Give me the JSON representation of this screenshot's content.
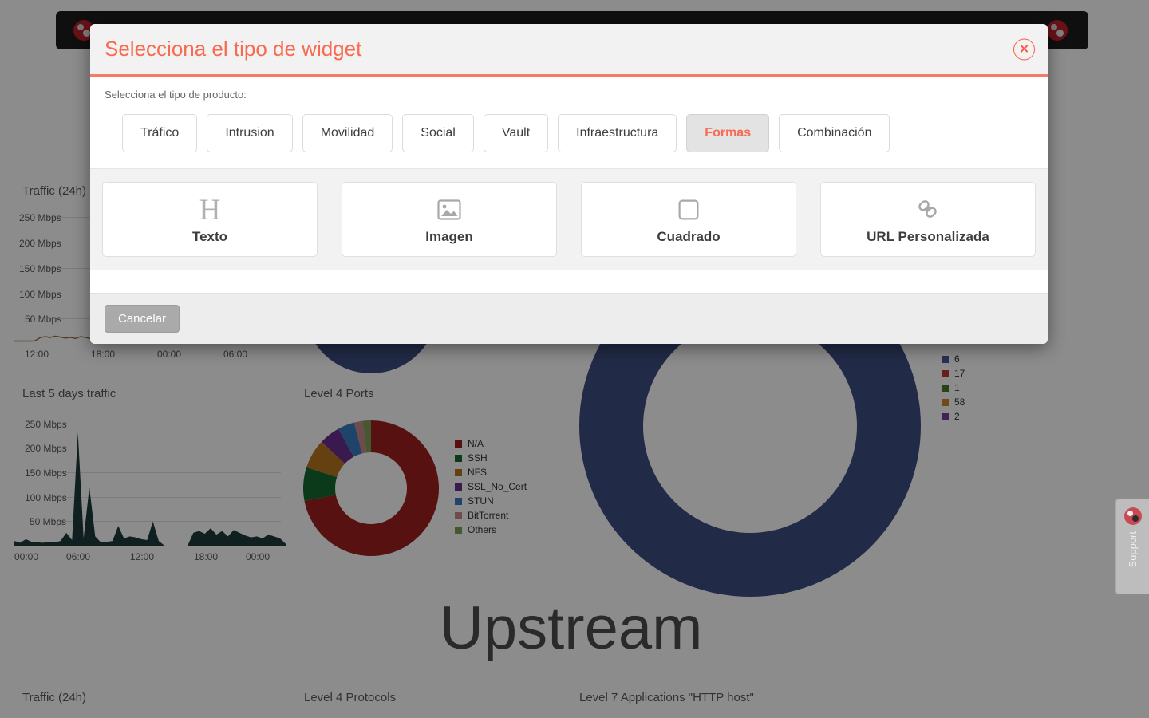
{
  "modal": {
    "title": "Selecciona el tipo de widget",
    "subtitle": "Selecciona el tipo de producto:",
    "close_icon": "close-icon",
    "close_glyph": "✕",
    "accent_color": "#fa6a50",
    "tabs": [
      {
        "label": "Tráfico",
        "active": false
      },
      {
        "label": "Intrusion",
        "active": false
      },
      {
        "label": "Movilidad",
        "active": false
      },
      {
        "label": "Social",
        "active": false
      },
      {
        "label": "Vault",
        "active": false
      },
      {
        "label": "Infraestructura",
        "active": false
      },
      {
        "label": "Formas",
        "active": true
      },
      {
        "label": "Combinación",
        "active": false
      }
    ],
    "widgets": [
      {
        "label": "Texto",
        "icon": "heading-h-icon"
      },
      {
        "label": "Imagen",
        "icon": "image-icon"
      },
      {
        "label": "Cuadrado",
        "icon": "square-icon"
      },
      {
        "label": "URL Personalizada",
        "icon": "link-chain-icon"
      }
    ],
    "footer": {
      "cancel_label": "Cancelar"
    }
  },
  "dashboard": {
    "upstream_label": "Upstream",
    "support_tab": {
      "label": "Support",
      "icon": "support-avatar-icon"
    },
    "navbar": {
      "left_icon": "app-logo-icon",
      "right_icon": "user-avatar-icon"
    },
    "panels": [
      {
        "title": "Traffic (24h)"
      },
      {
        "title": "Last 5 days traffic"
      },
      {
        "title": "Level 4 Ports"
      },
      {
        "title": "Traffic (24h)"
      },
      {
        "title": "Level 4 Protocols"
      },
      {
        "title": "Level 7 Applications \"HTTP host\""
      }
    ],
    "ring_legend": [
      {
        "value": "6",
        "color": "#4a5a9c"
      },
      {
        "value": "17",
        "color": "#c0392b"
      },
      {
        "value": "1",
        "color": "#4d7a28"
      },
      {
        "value": "58",
        "color": "#c8892a"
      },
      {
        "value": "2",
        "color": "#7a3b9c"
      }
    ]
  },
  "chart_data": [
    {
      "type": "line",
      "title": "Traffic (24h)",
      "xlabel": "",
      "ylabel": "",
      "ylim": [
        0,
        280
      ],
      "yticks": [
        "50 Mbps",
        "100 Mbps",
        "150 Mbps",
        "200 Mbps",
        "250 Mbps"
      ],
      "xticks": [
        "12:00",
        "18:00",
        "00:00",
        "06:00"
      ],
      "grid": true,
      "series": [
        {
          "name": "traffic",
          "color": "#8a6d3b",
          "values": [
            2,
            2,
            2,
            2,
            3,
            18,
            24,
            20,
            26,
            22,
            17,
            20,
            15,
            24,
            20,
            14,
            12,
            10,
            11,
            9,
            10,
            12,
            9,
            11,
            10,
            12,
            10,
            13,
            11,
            14,
            12,
            10,
            13,
            11,
            9,
            12,
            10,
            14,
            24,
            12,
            11,
            20,
            18,
            16,
            22,
            17,
            20,
            16
          ]
        }
      ]
    },
    {
      "type": "area",
      "title": "Last 5 days traffic",
      "xlabel": "",
      "ylabel": "",
      "ylim": [
        0,
        280
      ],
      "yticks": [
        "50 Mbps",
        "100 Mbps",
        "150 Mbps",
        "200 Mbps",
        "250 Mbps"
      ],
      "xticks": [
        "00:00",
        "06:00",
        "12:00",
        "18:00",
        "00:00"
      ],
      "grid": true,
      "series": [
        {
          "name": "traffic",
          "color": "#1e3b3b",
          "values": [
            12,
            8,
            16,
            10,
            9,
            8,
            10,
            9,
            12,
            30,
            14,
            250,
            18,
            130,
            22,
            9,
            10,
            12,
            45,
            18,
            22,
            20,
            16,
            14,
            55,
            12,
            2,
            1,
            1,
            1,
            1,
            30,
            34,
            28,
            40,
            26,
            34,
            22,
            36,
            30,
            24,
            20,
            22,
            18,
            26,
            22,
            18,
            6
          ]
        },
        {
          "name": "secondary",
          "color": "#9b6fa8",
          "values": [
            0,
            0,
            0,
            0,
            0,
            0,
            0,
            0,
            0,
            0,
            0,
            0,
            0,
            0,
            0,
            0,
            0,
            0,
            0,
            0,
            0,
            0,
            0,
            0,
            0,
            0,
            0,
            0,
            0,
            0,
            0,
            12,
            14,
            13,
            15,
            12,
            14,
            10,
            13,
            12,
            11,
            10,
            12,
            9,
            11,
            10,
            8,
            2
          ]
        }
      ]
    },
    {
      "type": "pie",
      "title": "Level 4 Ports",
      "labels": [
        "N/A",
        "SSH",
        "NFS",
        "SSL_No_Cert",
        "STUN",
        "BitTorrent",
        "Others"
      ],
      "values": [
        72,
        8,
        7,
        5,
        4,
        2,
        2
      ],
      "colors": [
        "#a01f1f",
        "#146b32",
        "#b8761f",
        "#6a2f8f",
        "#3b7cc0",
        "#c98a8a",
        "#7fa05a"
      ],
      "legend_position": "right"
    },
    {
      "type": "pie",
      "title": "Upstream",
      "labels": [
        "6",
        "17",
        "1",
        "58",
        "2"
      ],
      "values": [
        100,
        0,
        0,
        0,
        0
      ],
      "colors": [
        "#3c4d82",
        "#c0392b",
        "#4d7a28",
        "#c8892a",
        "#7a3b9c"
      ],
      "legend_position": "right"
    }
  ]
}
